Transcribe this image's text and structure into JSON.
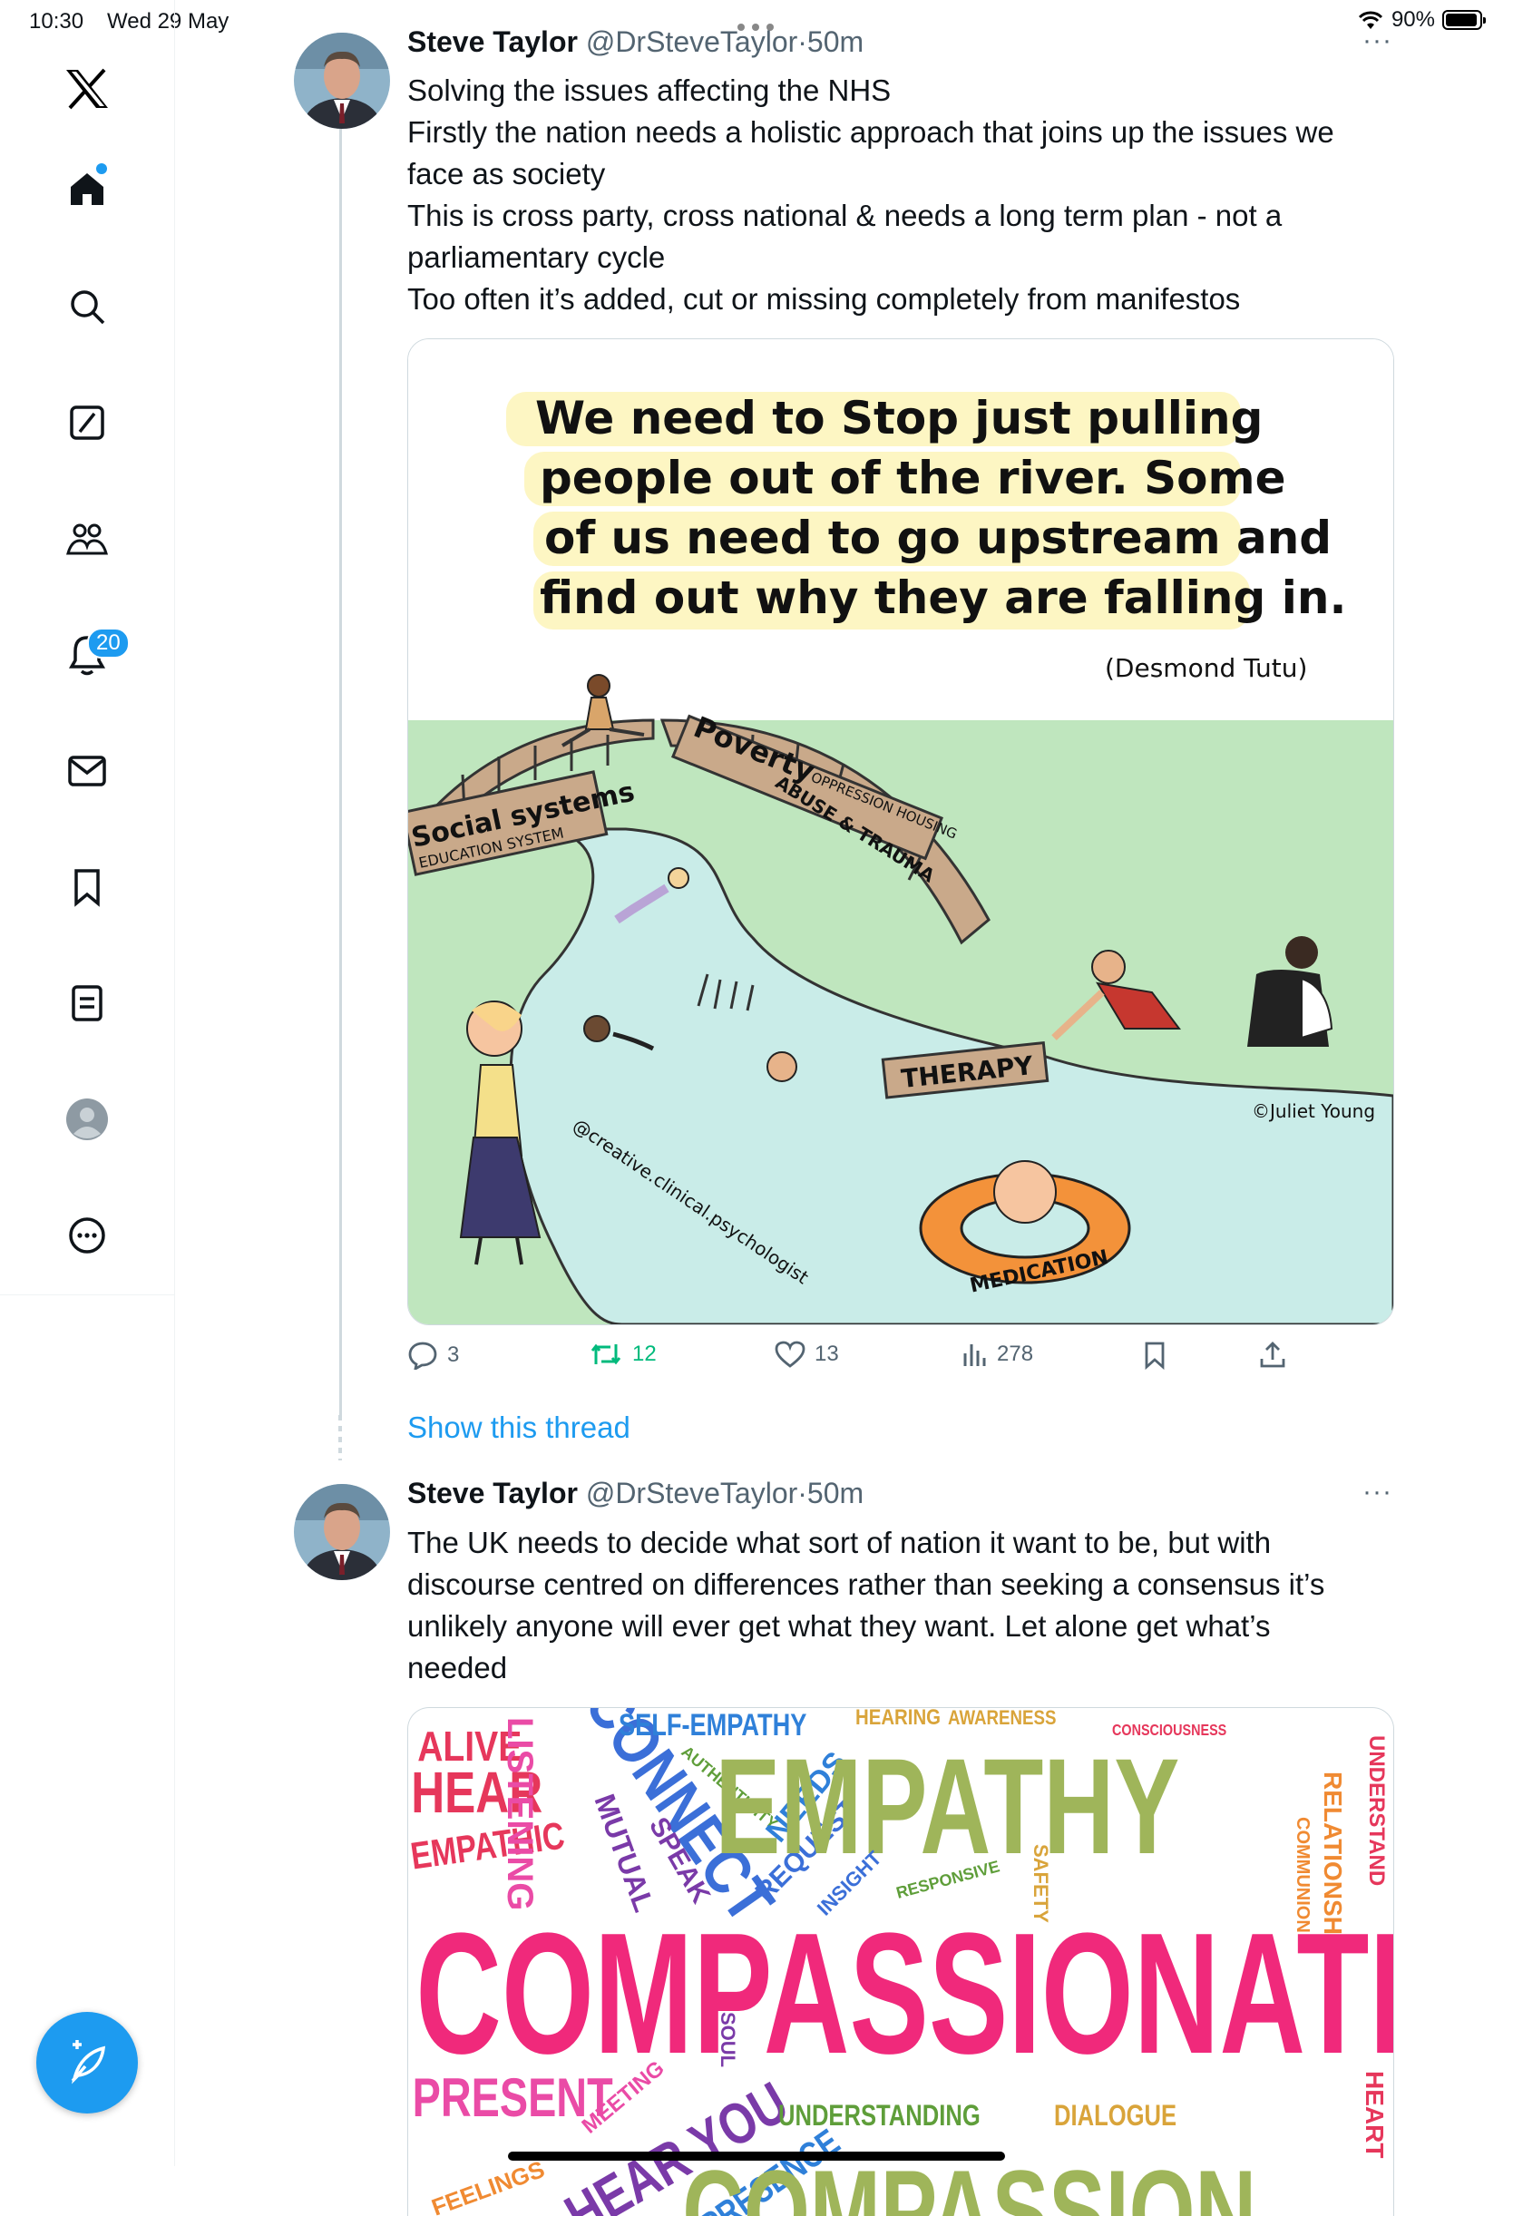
{
  "status_bar": {
    "time": "10:30",
    "date": "Wed 29 May",
    "battery": "90%"
  },
  "sidebar": {
    "notification_count": "20",
    "items": [
      "Home",
      "Search",
      "Grok",
      "Communities",
      "Notifications",
      "Messages",
      "Bookmarks",
      "Lists",
      "Profile",
      "More"
    ]
  },
  "tweets": [
    {
      "name": "Steve Taylor",
      "handle": "@DrSteveTaylor",
      "time": "50m",
      "lines": [
        "Solving the issues affecting the NHS",
        "Firstly the nation needs a holistic approach that joins up the issues we",
        "face as society",
        "This is cross party, cross national & needs a long term plan - not a",
        "parliamentary cycle",
        "Too often it’s added, cut or missing completely from manifestos"
      ],
      "image": {
        "quote_lines": [
          "We need to Stop just pulling",
          "people out of the river. Some",
          "of us need to go upstream and",
          "find out why they are falling in."
        ],
        "quote_author": "(Desmond Tutu)",
        "bridge1_main": "Social systems",
        "bridge1_sub": "EDUCATION SYSTEM",
        "bridge2_main": "Poverty",
        "bridge2_sub1": "OPPRESSION HOUSING",
        "bridge2_sub2": "ABUSE & TRAUMA",
        "plank": "THERAPY",
        "ring": "MEDICATION",
        "credit": "©Juliet Young",
        "watermark": "@creative.clinical.psychologist"
      },
      "stats": {
        "replies": "3",
        "retweets": "12",
        "likes": "13",
        "views": "278"
      }
    },
    {
      "name": "Steve Taylor",
      "handle": "@DrSteveTaylor",
      "time": "50m",
      "lines": [
        "The UK needs to decide what sort of nation it want to be, but with",
        "discourse centred on differences rather than seeking a consensus it’s",
        "unlikely anyone will ever get what they want. Let alone get what’s",
        "needed"
      ],
      "words": {
        "w1": "ALIVE",
        "w2": "HEAR",
        "w3": "EMPATHIC",
        "w4": "LISTENING",
        "w5": "MUTUAL",
        "w6": "CONNECT",
        "w7": "SPEAK",
        "w8": "SELF-EMPATHY",
        "w9": "AUTHENTICITY",
        "w10": "NEEDS",
        "w11": "REQUEST",
        "w12": "EMPATHY",
        "w13": "HEARING",
        "w14": "AWARENESS",
        "w15": "CONSCIOUSNESS",
        "w16": "UNDERSTAND",
        "w17": "RELATIONSHIP",
        "w18": "COMMUNION",
        "w19": "SAFETY",
        "w20": "INSIGHT",
        "w21": "RESPONSIVE",
        "w22": "COMPASSIONATE",
        "w23": "SOUL",
        "w24": "PRESENT",
        "w25": "MEETING",
        "w26": "HEAR YOU",
        "w27": "PRESENCE",
        "w28": "UNDERSTANDING",
        "w29": "DIALOGUE",
        "w30": "COMPASSION",
        "w31": "HEART",
        "w32": "FEELINGS"
      }
    }
  ],
  "show_thread": "Show this thread",
  "colors": {
    "accent": "#1d9bf0",
    "retweet": "#00ba7c",
    "grass": "#bfe6be",
    "river": "#c9ece8"
  }
}
